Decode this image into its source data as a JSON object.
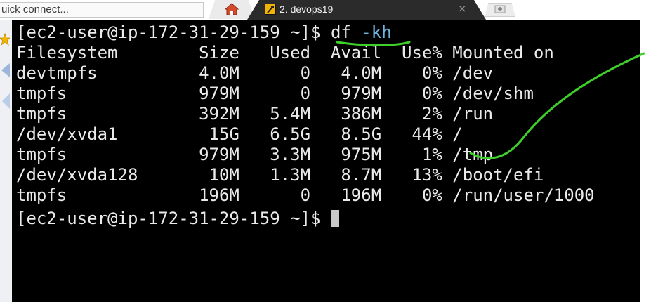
{
  "toolbar": {
    "quick_connect_placeholder": "uick connect..."
  },
  "tabs": [
    {
      "label": "2. devops19",
      "close_label": "×",
      "active": true
    }
  ],
  "icons": {
    "home": "home-icon",
    "session": "terminal-session-icon",
    "new_tab": "new-tab-icon"
  },
  "terminal": {
    "prompt": "[ec2-user@ip-172-31-29-159 ~]$ ",
    "command": "df",
    "command_args": "-kh",
    "header": {
      "filesystem": "Filesystem",
      "size": "Size",
      "used": "Used",
      "avail": "Avail",
      "use_pct": "Use%",
      "mounted": "Mounted on"
    },
    "rows": [
      {
        "filesystem": "devtmpfs",
        "size": "4.0M",
        "used": "0",
        "avail": "4.0M",
        "use_pct": "0%",
        "mounted": "/dev"
      },
      {
        "filesystem": "tmpfs",
        "size": "979M",
        "used": "0",
        "avail": "979M",
        "use_pct": "0%",
        "mounted": "/dev/shm"
      },
      {
        "filesystem": "tmpfs",
        "size": "392M",
        "used": "5.4M",
        "avail": "386M",
        "use_pct": "2%",
        "mounted": "/run"
      },
      {
        "filesystem": "/dev/xvda1",
        "size": "15G",
        "used": "6.5G",
        "avail": "8.5G",
        "use_pct": "44%",
        "mounted": "/"
      },
      {
        "filesystem": "tmpfs",
        "size": "979M",
        "used": "3.3M",
        "avail": "975M",
        "use_pct": "1%",
        "mounted": "/tmp"
      },
      {
        "filesystem": "/dev/xvda128",
        "size": "10M",
        "used": "1.3M",
        "avail": "8.7M",
        "use_pct": "13%",
        "mounted": "/boot/efi"
      },
      {
        "filesystem": "tmpfs",
        "size": "196M",
        "used": "0",
        "avail": "196M",
        "use_pct": "0%",
        "mounted": "/run/user/1000"
      }
    ],
    "final_prompt": "[ec2-user@ip-172-31-29-159 ~]$ "
  },
  "colors": {
    "terminal_bg": "#000000",
    "terminal_fg": "#eaeaea",
    "flag_color": "#6fb3e0",
    "annotation_color": "#3ecf2b",
    "active_tab_bg": "#2b2b2b",
    "tab_icon": "#f2b400"
  }
}
